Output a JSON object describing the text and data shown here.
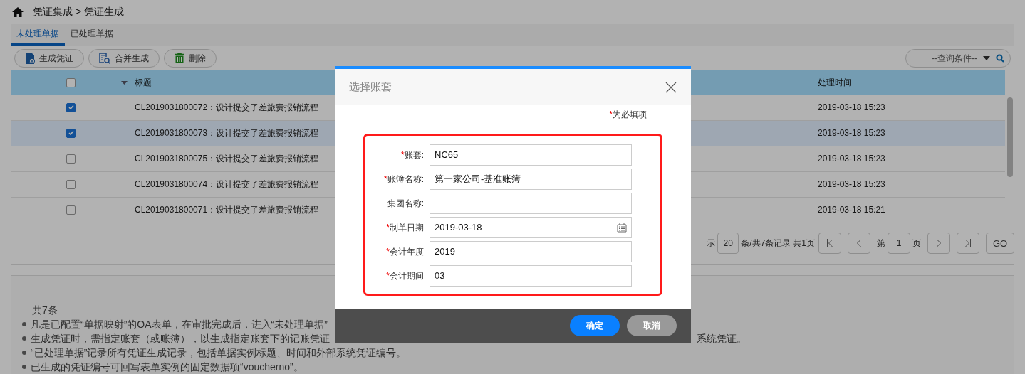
{
  "breadcrumb": "凭证集成 > 凭证生成",
  "tabs": [
    {
      "label": "未处理单据",
      "selected": true
    },
    {
      "label": "已处理单据",
      "selected": false
    }
  ],
  "toolbar": [
    {
      "label": "生成凭证",
      "kind": "generate"
    },
    {
      "label": "合并生成",
      "kind": "merge"
    },
    {
      "label": "删除",
      "kind": "delete"
    }
  ],
  "query": {
    "value": "--查询条件--"
  },
  "table": {
    "select_all_checked": false,
    "columns": [
      "标题",
      "处理时间"
    ],
    "rows": [
      {
        "checked": true,
        "selected": false,
        "title": "CL2019031800072：设计提交了差旅费报销流程",
        "time": "2019-03-18 15:23"
      },
      {
        "checked": true,
        "selected": true,
        "title": "CL2019031800073：设计提交了差旅费报销流程",
        "time": "2019-03-18 15:23"
      },
      {
        "checked": false,
        "selected": false,
        "title": "CL2019031800075：设计提交了差旅费报销流程",
        "time": "2019-03-18 15:23"
      },
      {
        "checked": false,
        "selected": false,
        "title": "CL2019031800074：设计提交了差旅费报销流程",
        "time": "2019-03-18 15:23"
      },
      {
        "checked": false,
        "selected": false,
        "title": "CL2019031800071：设计提交了差旅费报销流程",
        "time": "2019-03-18 15:21"
      }
    ]
  },
  "pager": {
    "label_fragment": "示",
    "page_size": "20",
    "summary": "条/共7条记录",
    "pages": "共1页",
    "page_prefix": "第",
    "page": "1",
    "page_suffix": "页",
    "go": "GO"
  },
  "notes": {
    "count": "共7条",
    "items": [
      {
        "text": "凡是已配置“单据映射”的OA表单，在审批完成后，进入“未处理单据”"
      },
      {
        "text": "生成凭证时，需指定账套（或账簿），以生成指定账套下的记账凭证",
        "tail": "系统凭证。"
      },
      {
        "text": "“已处理单据”记录所有凭证生成记录，包括单据实例标题、时间和外部系统凭证编号。"
      },
      {
        "text": "已生成的凭证编号可回写表单实例的固定数据项“voucherno”。"
      }
    ]
  },
  "dialog": {
    "title": "选择账套",
    "required_mark": "*",
    "required_note": "为必填项",
    "fields": [
      {
        "label": "账套:",
        "required": true,
        "value": "NC65",
        "kind": "text"
      },
      {
        "label": "账簿名称:",
        "required": true,
        "value": "第一家公司-基准账簿",
        "kind": "text"
      },
      {
        "label": "集团名称:",
        "required": false,
        "kind": "text"
      },
      {
        "label": "制单日期",
        "required": true,
        "value": "2019-03-18",
        "kind": "date"
      },
      {
        "label": "会计年度",
        "required": true,
        "value": "2019",
        "kind": "text"
      },
      {
        "label": "会计期间",
        "required": true,
        "value": "03",
        "kind": "text"
      }
    ],
    "buttons": [
      {
        "label": "确定",
        "kind": "primary"
      },
      {
        "label": "取消",
        "kind": "secondary"
      }
    ]
  }
}
